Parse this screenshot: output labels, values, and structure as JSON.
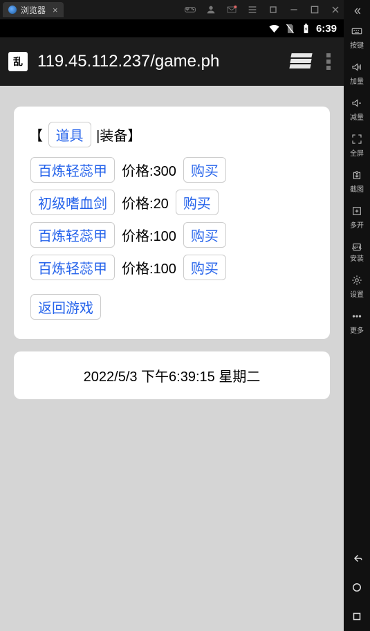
{
  "window": {
    "tab_title": "浏览器"
  },
  "status": {
    "clock": "6:39"
  },
  "urlbar": {
    "url": "119.45.112.237/game.ph"
  },
  "shop": {
    "bracket_open": "【",
    "bracket_close": "】",
    "category_active": "道具",
    "category_sep": "|",
    "category_other": "装备",
    "price_prefix": "价格:",
    "buy_label": "购买",
    "items": [
      {
        "name": "百炼轻蕊甲",
        "price": "300"
      },
      {
        "name": "初级嗜血剑",
        "price": "20"
      },
      {
        "name": "百炼轻蕊甲",
        "price": "100"
      },
      {
        "name": "百炼轻蕊甲",
        "price": "100"
      }
    ],
    "back_label": "返回游戏"
  },
  "timestamp": "2022/5/3 下午6:39:15 星期二",
  "emu": {
    "keys": "按键",
    "vol_up": "加量",
    "vol_down": "减量",
    "fullscreen": "全屏",
    "screenshot": "截图",
    "multi": "多开",
    "install": "安装",
    "settings": "设置",
    "more": "更多",
    "apk": "APK"
  }
}
